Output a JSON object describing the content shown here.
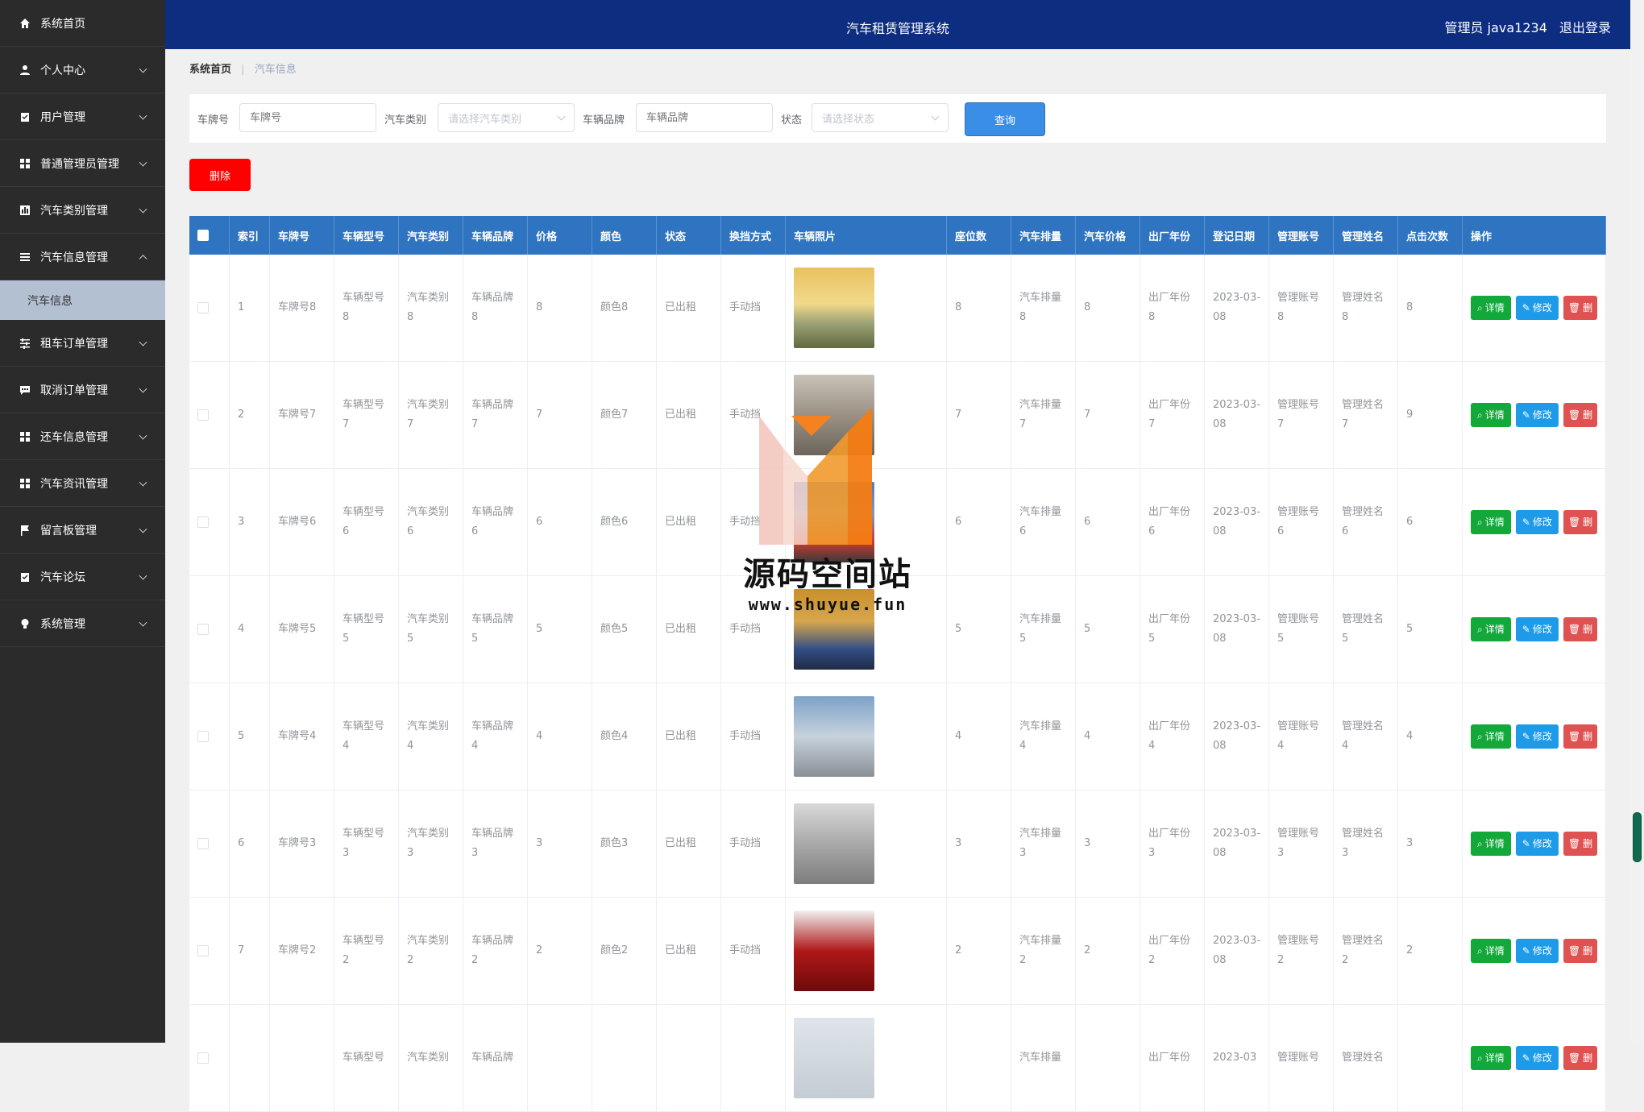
{
  "sidebar": {
    "items": [
      {
        "label": "系统首页",
        "icon": "home-icon"
      },
      {
        "label": "个人中心",
        "icon": "user-icon"
      },
      {
        "label": "用户管理",
        "icon": "clipboard-icon"
      },
      {
        "label": "普通管理员管理",
        "icon": "grid-icon"
      },
      {
        "label": "汽车类别管理",
        "icon": "chart-icon"
      },
      {
        "label": "汽车信息管理",
        "icon": "list-icon",
        "expanded": true
      },
      {
        "label": "租车订单管理",
        "icon": "sliders-icon"
      },
      {
        "label": "取消订单管理",
        "icon": "message-icon"
      },
      {
        "label": "还车信息管理",
        "icon": "grid-icon"
      },
      {
        "label": "汽车资讯管理",
        "icon": "grid-icon"
      },
      {
        "label": "留言板管理",
        "icon": "flag-icon"
      },
      {
        "label": "汽车论坛",
        "icon": "checklist-icon"
      },
      {
        "label": "系统管理",
        "icon": "bulb-icon"
      }
    ],
    "subitem": "汽车信息"
  },
  "header": {
    "title": "汽车租赁管理系统",
    "user": "管理员 java1234",
    "logout": "退出登录"
  },
  "breadcrumb": {
    "home": "系统首页",
    "current": "汽车信息"
  },
  "search": {
    "plate_label": "车牌号",
    "plate_placeholder": "车牌号",
    "type_label": "汽车类别",
    "type_placeholder": "请选择汽车类别",
    "brand_label": "车辆品牌",
    "brand_placeholder": "车辆品牌",
    "status_label": "状态",
    "status_placeholder": "请选择状态",
    "query_label": "查询"
  },
  "delete_button": "删除",
  "table": {
    "headers": [
      "索引",
      "车牌号",
      "车辆型号",
      "汽车类别",
      "车辆品牌",
      "价格",
      "颜色",
      "状态",
      "换挡方式",
      "车辆照片",
      "座位数",
      "汽车排量",
      "汽车价格",
      "出厂年份",
      "登记日期",
      "管理账号",
      "管理姓名",
      "点击次数",
      "操作"
    ],
    "actions": {
      "detail": "详情",
      "edit": "修改",
      "delete": "删"
    },
    "rows": [
      {
        "index": "1",
        "plate": "车牌号8",
        "model": "车辆型号8",
        "type": "汽车类别8",
        "brand": "车辆品牌8",
        "price": "8",
        "color": "颜色8",
        "status": "已出租",
        "gear": "手动挡",
        "seats": "8",
        "displacement": "汽车排量8",
        "car_price": "8",
        "year": "出厂年份8",
        "date": "2023-03-08",
        "account": "管理账号8",
        "name": "管理姓名8",
        "clicks": "8"
      },
      {
        "index": "2",
        "plate": "车牌号7",
        "model": "车辆型号7",
        "type": "汽车类别7",
        "brand": "车辆品牌7",
        "price": "7",
        "color": "颜色7",
        "status": "已出租",
        "gear": "手动挡",
        "seats": "7",
        "displacement": "汽车排量7",
        "car_price": "7",
        "year": "出厂年份7",
        "date": "2023-03-08",
        "account": "管理账号7",
        "name": "管理姓名7",
        "clicks": "9"
      },
      {
        "index": "3",
        "plate": "车牌号6",
        "model": "车辆型号6",
        "type": "汽车类别6",
        "brand": "车辆品牌6",
        "price": "6",
        "color": "颜色6",
        "status": "已出租",
        "gear": "手动挡",
        "seats": "6",
        "displacement": "汽车排量6",
        "car_price": "6",
        "year": "出厂年份6",
        "date": "2023-03-08",
        "account": "管理账号6",
        "name": "管理姓名6",
        "clicks": "6"
      },
      {
        "index": "4",
        "plate": "车牌号5",
        "model": "车辆型号5",
        "type": "汽车类别5",
        "brand": "车辆品牌5",
        "price": "5",
        "color": "颜色5",
        "status": "已出租",
        "gear": "手动挡",
        "seats": "5",
        "displacement": "汽车排量5",
        "car_price": "5",
        "year": "出厂年份5",
        "date": "2023-03-08",
        "account": "管理账号5",
        "name": "管理姓名5",
        "clicks": "5"
      },
      {
        "index": "5",
        "plate": "车牌号4",
        "model": "车辆型号4",
        "type": "汽车类别4",
        "brand": "车辆品牌4",
        "price": "4",
        "color": "颜色4",
        "status": "已出租",
        "gear": "手动挡",
        "seats": "4",
        "displacement": "汽车排量4",
        "car_price": "4",
        "year": "出厂年份4",
        "date": "2023-03-08",
        "account": "管理账号4",
        "name": "管理姓名4",
        "clicks": "4"
      },
      {
        "index": "6",
        "plate": "车牌号3",
        "model": "车辆型号3",
        "type": "汽车类别3",
        "brand": "车辆品牌3",
        "price": "3",
        "color": "颜色3",
        "status": "已出租",
        "gear": "手动挡",
        "seats": "3",
        "displacement": "汽车排量3",
        "car_price": "3",
        "year": "出厂年份3",
        "date": "2023-03-08",
        "account": "管理账号3",
        "name": "管理姓名3",
        "clicks": "3"
      },
      {
        "index": "7",
        "plate": "车牌号2",
        "model": "车辆型号2",
        "type": "汽车类别2",
        "brand": "车辆品牌2",
        "price": "2",
        "color": "颜色2",
        "status": "已出租",
        "gear": "手动挡",
        "seats": "2",
        "displacement": "汽车排量2",
        "car_price": "2",
        "year": "出厂年份2",
        "date": "2023-03-08",
        "account": "管理账号2",
        "name": "管理姓名2",
        "clicks": "2"
      },
      {
        "index": "",
        "plate": "",
        "model": "车辆型号",
        "type": "汽车类别",
        "brand": "车辆品牌",
        "price": "",
        "color": "",
        "status": "",
        "gear": "",
        "seats": "",
        "displacement": "汽车排量",
        "car_price": "",
        "year": "出厂年份",
        "date": "2023-03",
        "account": "管理账号",
        "name": "管理姓名",
        "clicks": ""
      }
    ]
  },
  "watermark": {
    "title": "源码空间站",
    "url": "www.shuyue.fun"
  },
  "colors": {
    "header": "#0d2d80",
    "sidebar": "#2b2b2b",
    "table_header": "#2e74c0",
    "detail": "#13a83a",
    "edit": "#1e9be8",
    "delete": "#ff0000"
  }
}
